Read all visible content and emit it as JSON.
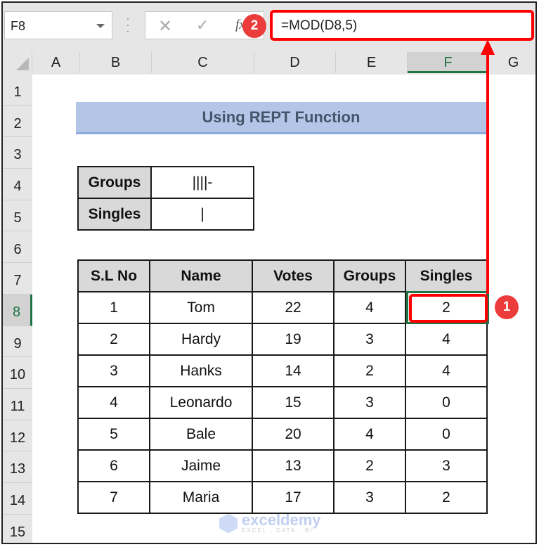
{
  "formula_bar": {
    "name_box": "F8",
    "cancel_icon": "✕",
    "enter_icon": "✓",
    "fx_label": "fx",
    "formula": "=MOD(D8,5)"
  },
  "columns": [
    "A",
    "B",
    "C",
    "D",
    "E",
    "F",
    "G"
  ],
  "selected_column": "F",
  "rows": [
    "1",
    "2",
    "3",
    "4",
    "5",
    "6",
    "7",
    "8",
    "9",
    "10",
    "11",
    "12",
    "13",
    "14",
    "15"
  ],
  "selected_row": "8",
  "title": "Using REPT Function",
  "legend": [
    {
      "label": "Groups",
      "symbol": "||||-"
    },
    {
      "label": "Singles",
      "symbol": "|"
    }
  ],
  "table": {
    "headers": [
      "S.L No",
      "Name",
      "Votes",
      "Groups",
      "Singles"
    ],
    "rows": [
      [
        "1",
        "Tom",
        "22",
        "4",
        "2"
      ],
      [
        "2",
        "Hardy",
        "19",
        "3",
        "4"
      ],
      [
        "3",
        "Hanks",
        "14",
        "2",
        "4"
      ],
      [
        "4",
        "Leonardo",
        "15",
        "3",
        "0"
      ],
      [
        "5",
        "Bale",
        "20",
        "4",
        "0"
      ],
      [
        "6",
        "Jaime",
        "13",
        "2",
        "3"
      ],
      [
        "7",
        "Maria",
        "17",
        "3",
        "2"
      ]
    ]
  },
  "annotations": {
    "badge_1": "1",
    "badge_2": "2",
    "color": "#ff0000"
  },
  "watermark": {
    "name": "exceldemy",
    "tagline": "EXCEL · DATA · BI"
  }
}
